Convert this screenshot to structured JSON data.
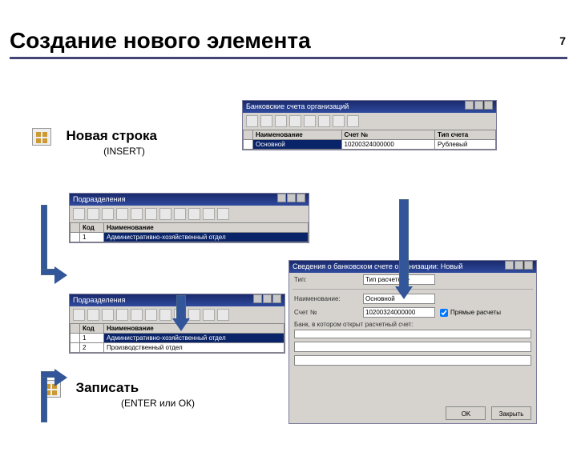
{
  "page_number": "7",
  "title": "Создание нового элемента",
  "insert_block": {
    "label": "Новая строка",
    "caption": "(INSERT)"
  },
  "save_block": {
    "label": "Записать",
    "caption": "(ENTER или ОК)"
  },
  "win1": {
    "title": "Банковские счета организаций",
    "cols": [
      "",
      "Наименование",
      "Счет №",
      "Тип счета"
    ],
    "row": [
      "",
      "Основной",
      "10200324000000",
      "Рублевый"
    ]
  },
  "win2": {
    "title": "Подразделения",
    "cols": [
      "",
      "Код",
      "Наименование"
    ],
    "row": [
      "",
      "1",
      "Административно-хозяйственный отдел"
    ]
  },
  "win3": {
    "title": "Подразделения",
    "cols": [
      "",
      "Код",
      "Наименование"
    ],
    "rows": [
      [
        "",
        "1",
        "Административно-хозяйственный отдел"
      ],
      [
        "",
        "2",
        "Производственный отдел"
      ]
    ]
  },
  "win4": {
    "title": "Сведения о банковском счете организации: Новый",
    "fields": {
      "tip": {
        "label": "Тип:",
        "value": "Тип расчетные"
      },
      "name": {
        "label": "Наименование:",
        "value": "Основной"
      },
      "acct": {
        "label": "Счет №",
        "value": "10200324000000"
      },
      "bank": {
        "label": "Банк, в котором открыт расчетный счет:",
        "value": ""
      },
      "prov": {
        "label": "Прямые расчеты",
        "checked": true
      }
    },
    "buttons": {
      "ok": "OK",
      "close": "Закрыть"
    }
  }
}
